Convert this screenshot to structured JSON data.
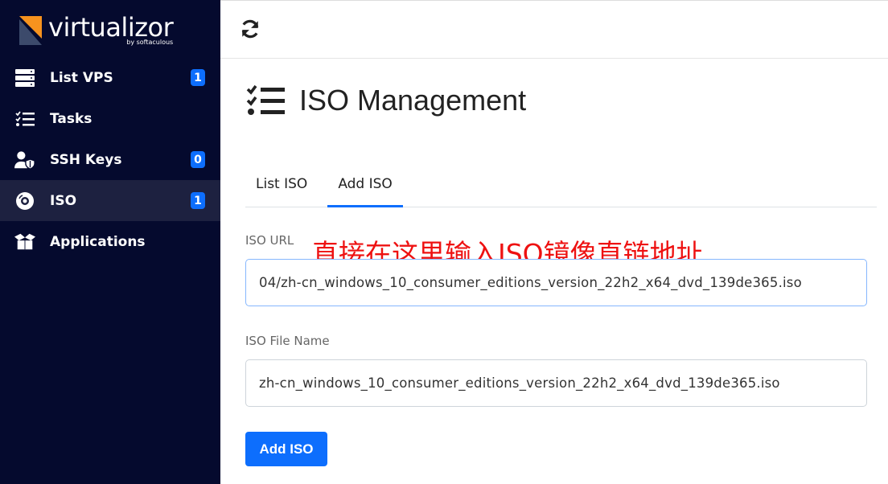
{
  "brand": {
    "name": "virtualizor",
    "by": "by softaculous",
    "accent": "#f7931e"
  },
  "sidebar": {
    "items": [
      {
        "label": "List VPS",
        "icon": "server-icon",
        "badge": "1"
      },
      {
        "label": "Tasks",
        "icon": "task-list-icon",
        "badge": null
      },
      {
        "label": "SSH Keys",
        "icon": "user-shield-icon",
        "badge": "0"
      },
      {
        "label": "ISO",
        "icon": "disc-icon",
        "badge": "1",
        "active": true
      },
      {
        "label": "Applications",
        "icon": "box-open-icon",
        "badge": null
      }
    ]
  },
  "topbar": {
    "icon": "refresh-icon"
  },
  "page": {
    "title": "ISO Management",
    "icon": "task-list-icon"
  },
  "tabs": [
    {
      "label": "List ISO"
    },
    {
      "label": "Add ISO",
      "active": true
    }
  ],
  "form": {
    "url_label": "ISO URL",
    "url_value": "04/zh-cn_windows_10_consumer_editions_version_22h2_x64_dvd_139de365.iso",
    "annotation": "直接在这里输入ISO镜像直链地址",
    "name_label": "ISO File Name",
    "name_value": "zh-cn_windows_10_consumer_editions_version_22h2_x64_dvd_139de365.iso",
    "submit_label": "Add ISO"
  },
  "colors": {
    "sidebar_bg": "#050a2e",
    "primary": "#0d6efd",
    "annotation": "#ee1111"
  }
}
